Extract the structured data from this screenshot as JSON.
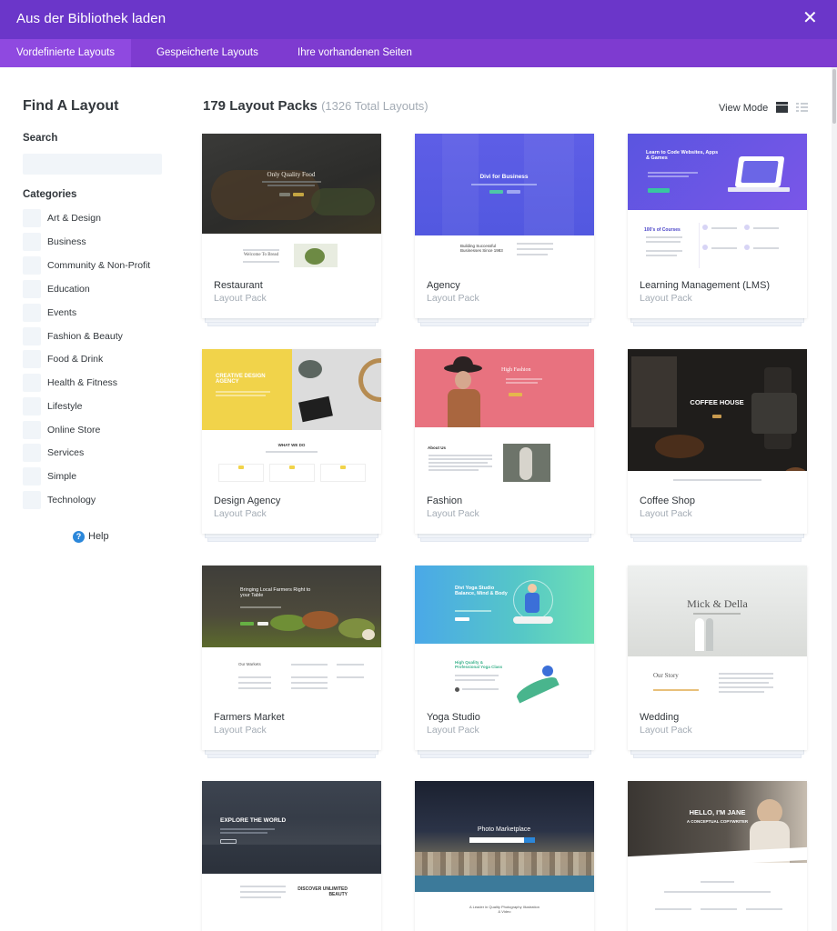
{
  "window": {
    "title": "Aus der Bibliothek laden",
    "close_symbol": "✕"
  },
  "tabs": [
    {
      "label": "Vordefinierte Layouts",
      "active": true
    },
    {
      "label": "Gespeicherte Layouts",
      "active": false
    },
    {
      "label": "Ihre vorhandenen Seiten",
      "active": false
    }
  ],
  "sidebar": {
    "title": "Find A Layout",
    "search_label": "Search",
    "search_value": "",
    "categories_label": "Categories",
    "categories": [
      "Art & Design",
      "Business",
      "Community & Non-Profit",
      "Education",
      "Events",
      "Fashion & Beauty",
      "Food & Drink",
      "Health & Fitness",
      "Lifestyle",
      "Online Store",
      "Services",
      "Simple",
      "Technology"
    ],
    "help_label": "Help",
    "help_icon": "?"
  },
  "main": {
    "count_label": "179 Layout Packs",
    "total_label": "(1326 Total Layouts)",
    "view_mode_label": "View Mode"
  },
  "cards": [
    {
      "name": "Restaurant",
      "sub": "Layout Pack",
      "thumb": {
        "hero_title": "Only Quality Food",
        "body_text": "Welcome To Bread"
      }
    },
    {
      "name": "Agency",
      "sub": "Layout Pack",
      "thumb": {
        "hero_title": "Divi for Business",
        "body_text": "Building Successful Businesses Since 1983"
      }
    },
    {
      "name": "Learning Management (LMS)",
      "sub": "Layout Pack",
      "thumb": {
        "hero_title": "Learn to Code Websites, Apps & Games",
        "body_text": "100's of Courses"
      }
    },
    {
      "name": "Design Agency",
      "sub": "Layout Pack",
      "thumb": {
        "hero_title": "CREATIVE DESIGN AGENCY",
        "body_text": "WHAT WE DO"
      }
    },
    {
      "name": "Fashion",
      "sub": "Layout Pack",
      "thumb": {
        "hero_title": "High Fashion",
        "body_text": "About Us"
      }
    },
    {
      "name": "Coffee Shop",
      "sub": "Layout Pack",
      "thumb": {
        "hero_title": "COFFEE HOUSE",
        "body_text": ""
      }
    },
    {
      "name": "Farmers Market",
      "sub": "Layout Pack",
      "thumb": {
        "hero_title": "Bringing Local Farmers Right to your Table",
        "body_text": "Our Markets"
      }
    },
    {
      "name": "Yoga Studio",
      "sub": "Layout Pack",
      "thumb": {
        "hero_title": "Divi Yoga Studio Balance, Mind & Body",
        "body_text": "High Quality & Professional Yoga Class"
      }
    },
    {
      "name": "Wedding",
      "sub": "Layout Pack",
      "thumb": {
        "hero_title": "Mick & Della",
        "body_text": "Our Story"
      }
    },
    {
      "name": "",
      "sub": "",
      "thumb": {
        "hero_title": "EXPLORE THE WORLD",
        "body_text": "DISCOVER UNLIMITED BEAUTY"
      }
    },
    {
      "name": "",
      "sub": "",
      "thumb": {
        "hero_title": "Photo Marketplace",
        "body_text": "A Leader in Quality Photography Illustration & Video"
      }
    },
    {
      "name": "",
      "sub": "",
      "thumb": {
        "hero_title": "HELLO, I'M JANE",
        "body_text": "A CONCEPTUAL COPYWRITER"
      }
    }
  ],
  "colors": {
    "titlebar": "#6b36c9",
    "tabbar": "#7e3bd0",
    "tab_active": "#8f49e0",
    "help_icon": "#2b87da",
    "muted_text": "#a3abb4"
  }
}
